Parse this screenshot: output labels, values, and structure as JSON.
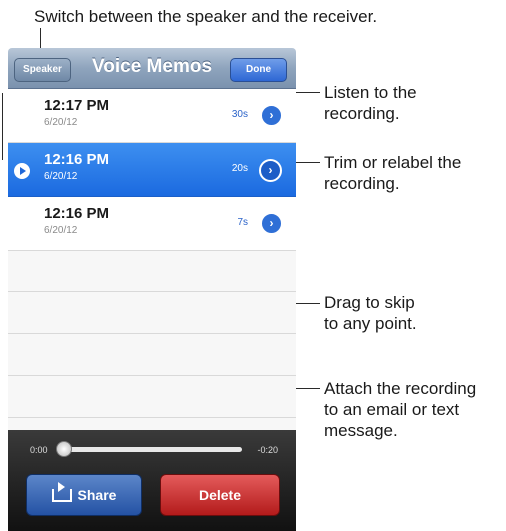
{
  "annotations": {
    "speaker": "Switch between the speaker and the receiver.",
    "listen_1": "Listen to the",
    "listen_2": "recording.",
    "trim_1": "Trim or relabel the",
    "trim_2": "recording.",
    "drag_1": "Drag to skip",
    "drag_2": "to any point.",
    "attach_1": "Attach the recording",
    "attach_2": "to an email or text",
    "attach_3": "message."
  },
  "navbar": {
    "title": "Voice Memos",
    "speaker_label": "Speaker",
    "done_label": "Done"
  },
  "recordings": [
    {
      "time": "12:17 PM",
      "date": "6/20/12",
      "duration": "30s"
    },
    {
      "time": "12:16 PM",
      "date": "6/20/12",
      "duration": "20s"
    },
    {
      "time": "12:16 PM",
      "date": "6/20/12",
      "duration": "7s"
    }
  ],
  "playback": {
    "elapsed": "0:00",
    "remaining": "-0:20",
    "progress": 0
  },
  "actions": {
    "share_label": "Share",
    "delete_label": "Delete"
  },
  "colors": {
    "selected_row": "#1b6ae0",
    "delete": "#b31b1b",
    "share": "#2452a4"
  }
}
